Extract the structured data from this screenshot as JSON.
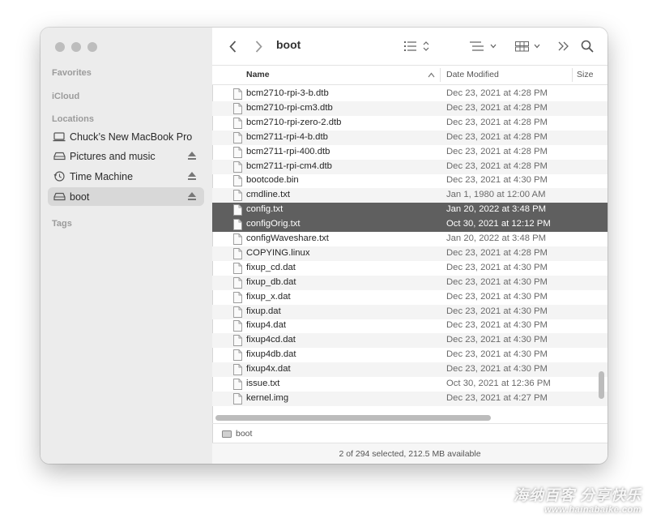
{
  "sidebar": {
    "favorites_heading": "Favorites",
    "icloud_heading": "iCloud",
    "locations_heading": "Locations",
    "tags_heading": "Tags",
    "items": [
      {
        "label": "Chuck’s New MacBook Pro",
        "icon": "laptop-icon"
      },
      {
        "label": "Pictures and music",
        "icon": "drive-icon"
      },
      {
        "label": "Time Machine",
        "icon": "time-machine-icon"
      },
      {
        "label": "boot",
        "icon": "drive-icon"
      }
    ]
  },
  "toolbar": {
    "title": "boot"
  },
  "columns": {
    "name": "Name",
    "date": "Date Modified",
    "size": "Size"
  },
  "files": [
    {
      "name": "bcm2710-rpi-3-b.dtb",
      "date": "Dec 23, 2021 at 4:28 PM"
    },
    {
      "name": "bcm2710-rpi-cm3.dtb",
      "date": "Dec 23, 2021 at 4:28 PM"
    },
    {
      "name": "bcm2710-rpi-zero-2.dtb",
      "date": "Dec 23, 2021 at 4:28 PM"
    },
    {
      "name": "bcm2711-rpi-4-b.dtb",
      "date": "Dec 23, 2021 at 4:28 PM"
    },
    {
      "name": "bcm2711-rpi-400.dtb",
      "date": "Dec 23, 2021 at 4:28 PM"
    },
    {
      "name": "bcm2711-rpi-cm4.dtb",
      "date": "Dec 23, 2021 at 4:28 PM"
    },
    {
      "name": "bootcode.bin",
      "date": "Dec 23, 2021 at 4:30 PM"
    },
    {
      "name": "cmdline.txt",
      "date": "Jan 1, 1980 at 12:00 AM"
    },
    {
      "name": "config.txt",
      "date": "Jan 20, 2022 at 3:48 PM"
    },
    {
      "name": "configOrig.txt",
      "date": "Oct 30, 2021 at 12:12 PM"
    },
    {
      "name": "configWaveshare.txt",
      "date": "Jan 20, 2022 at 3:48 PM"
    },
    {
      "name": "COPYING.linux",
      "date": "Dec 23, 2021 at 4:28 PM"
    },
    {
      "name": "fixup_cd.dat",
      "date": "Dec 23, 2021 at 4:30 PM"
    },
    {
      "name": "fixup_db.dat",
      "date": "Dec 23, 2021 at 4:30 PM"
    },
    {
      "name": "fixup_x.dat",
      "date": "Dec 23, 2021 at 4:30 PM"
    },
    {
      "name": "fixup.dat",
      "date": "Dec 23, 2021 at 4:30 PM"
    },
    {
      "name": "fixup4.dat",
      "date": "Dec 23, 2021 at 4:30 PM"
    },
    {
      "name": "fixup4cd.dat",
      "date": "Dec 23, 2021 at 4:30 PM"
    },
    {
      "name": "fixup4db.dat",
      "date": "Dec 23, 2021 at 4:30 PM"
    },
    {
      "name": "fixup4x.dat",
      "date": "Dec 23, 2021 at 4:30 PM"
    },
    {
      "name": "issue.txt",
      "date": "Oct 30, 2021 at 12:36 PM"
    },
    {
      "name": "kernel.img",
      "date": "Dec 23, 2021 at 4:27 PM"
    }
  ],
  "pathbar": {
    "label": "boot"
  },
  "status": {
    "text": "2 of 294 selected, 212.5 MB available"
  },
  "watermark": {
    "text": "海纳百客 分享快乐",
    "url": "www.hainabaike.com"
  },
  "colors": {
    "selection": "#5f5f5f",
    "sidebar_bg": "#ececec"
  }
}
